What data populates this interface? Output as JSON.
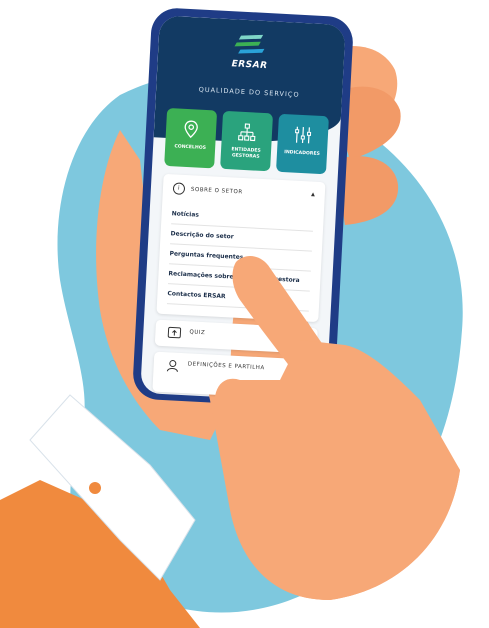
{
  "app": {
    "brand": "ERSAR",
    "section_title": "QUALIDADE DO SERVIÇO"
  },
  "tiles": [
    {
      "label": "CONCELHOS",
      "icon": "map-pin-icon",
      "color": "#3cb054"
    },
    {
      "label": "ENTIDADES GESTORAS",
      "icon": "network-icon",
      "color": "#2aa37d"
    },
    {
      "label": "INDICADORES",
      "icon": "sliders-icon",
      "color": "#1e8ea0"
    }
  ],
  "about": {
    "heading": "SOBRE O SETOR",
    "info_icon": "i",
    "caret": "▲",
    "items": [
      "Notícias",
      "Descrição do setor",
      "Perguntas frequentes",
      "Reclamações sobre a entidade gestora",
      "Contactos ERSAR"
    ]
  },
  "quiz": {
    "label": "QUIZ"
  },
  "settings": {
    "label": "DEFINIÇÕES E PARTILHA"
  },
  "colors": {
    "background_blob": "#7ec8de",
    "phone_frame": "#1f3c86",
    "header": "#123a63",
    "skin": "#f7a877",
    "sleeve": "#f08a3e",
    "cuff": "#ffffff"
  }
}
